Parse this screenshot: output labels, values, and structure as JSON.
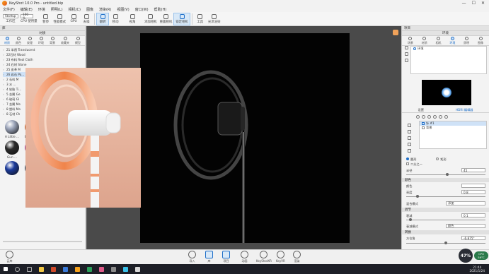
{
  "window": {
    "title": "KeyShot 10.0 Pro - untitled.bip",
    "controls": [
      "—",
      "☐",
      "✕"
    ]
  },
  "menu": [
    "文件(F)",
    "编辑(E)",
    "环境",
    "照明(L)",
    "相机(C)",
    "图像",
    "渲染(R)",
    "视图(V)",
    "窗口(W)",
    "帮助(H)"
  ],
  "toolbar": {
    "workspace_select": "Startup",
    "zoom_select": "100 %",
    "items": [
      {
        "label": "工作区"
      },
      {
        "label": "CPU 使用量"
      },
      {
        "label": "暂停"
      },
      {
        "label": "性能模式"
      },
      {
        "label": "GPU"
      },
      {
        "label": "去噪"
      },
      {
        "label": "翻转"
      },
      {
        "label": "移动"
      },
      {
        "label": "视角"
      },
      {
        "label": "添加相机"
      },
      {
        "label": "重置相机"
      },
      {
        "label": "锁定相机"
      },
      {
        "label": "工具"
      },
      {
        "label": "光泽渲染"
      }
    ]
  },
  "left_panel": {
    "title": "库",
    "header": "材质",
    "tabs": [
      "材质",
      "颜色",
      "纹理",
      "环境",
      "背景",
      "收藏夹",
      "模型"
    ],
    "tree": [
      "21 半透 Translucent",
      "22石材 Wood",
      "23 布料 Real Cloth",
      "24 石材 Stone",
      "25 皮革 M",
      "26 岩石 Pa...",
      "2 石料 M",
      "3 水 ...",
      "4 轮胎 Ti...",
      "5 金属 Ge",
      "6 玻璃 Gl",
      "7 金属 Me",
      "8 塑料 Mo",
      "8 石材 Ch"
    ],
    "swatches": [
      {
        "label": "A Little ...",
        "color": "#9aa3b8"
      },
      {
        "label": "Blazing ...",
        "color": "#c4581b"
      },
      {
        "label": "Cappucci...",
        "color": "#5a3a2a"
      },
      {
        "label": "Fire ...",
        "color": "#b22a15"
      },
      {
        "label": "Gun ...",
        "color": "#2a2a2a"
      },
      {
        "label": "Hot ...",
        "color": "#a02a8a"
      },
      {
        "label": "Hot ...",
        "color": "#8a1526"
      },
      {
        "label": "Iguana ...",
        "color": "#8a9a25"
      },
      {
        "label": "",
        "color": "#1b3a9a"
      },
      {
        "label": "",
        "color": "#0c3a5a"
      },
      {
        "label": "",
        "color": "#1a7a6a"
      },
      {
        "label": "",
        "color": "#25305a"
      }
    ]
  },
  "right_panel": {
    "title": "项目",
    "header": "环境",
    "tabs": [
      "场景",
      "材质",
      "相机",
      "环境",
      "照明",
      "图像"
    ],
    "env_item": "环境",
    "sub_tabs": [
      "设置",
      "HDRI 编辑器"
    ],
    "light_item": "针 #1",
    "bg_item": "背景",
    "options": [
      "圆形",
      "矩形",
      "二分之一"
    ],
    "radius_label": "半径",
    "radius_value": "45",
    "section_color": "颜色",
    "color_label": "颜色",
    "brightness_label": "亮度",
    "brightness_value": "0.8",
    "blend_label": "混合模式",
    "blend_value": "添加",
    "section_falloff": "调节",
    "falloff_label": "衰减",
    "falloff_value": "0.1",
    "falloff_mode_label": "衰减模式",
    "falloff_mode_value": "颜色",
    "section_transform": "转换",
    "azimuth_label": "方位角",
    "azimuth_value": "-6.875°"
  },
  "bottombar": {
    "left_label": "云库",
    "buttons": [
      "导入",
      "库",
      "项目",
      "动画",
      "KeyShotXR",
      "KeyVR",
      "渲染"
    ]
  },
  "taskbar": {
    "time": "21:44",
    "date": "2021/1/24",
    "badge_percent": "47%",
    "badge_sub": "CPU",
    "temp": "59°C"
  },
  "colors": {
    "accent": "#1e6fc9",
    "render_bg": "#030303",
    "photo_bg": "#e7b9a6",
    "orange": "#f08a4b"
  }
}
